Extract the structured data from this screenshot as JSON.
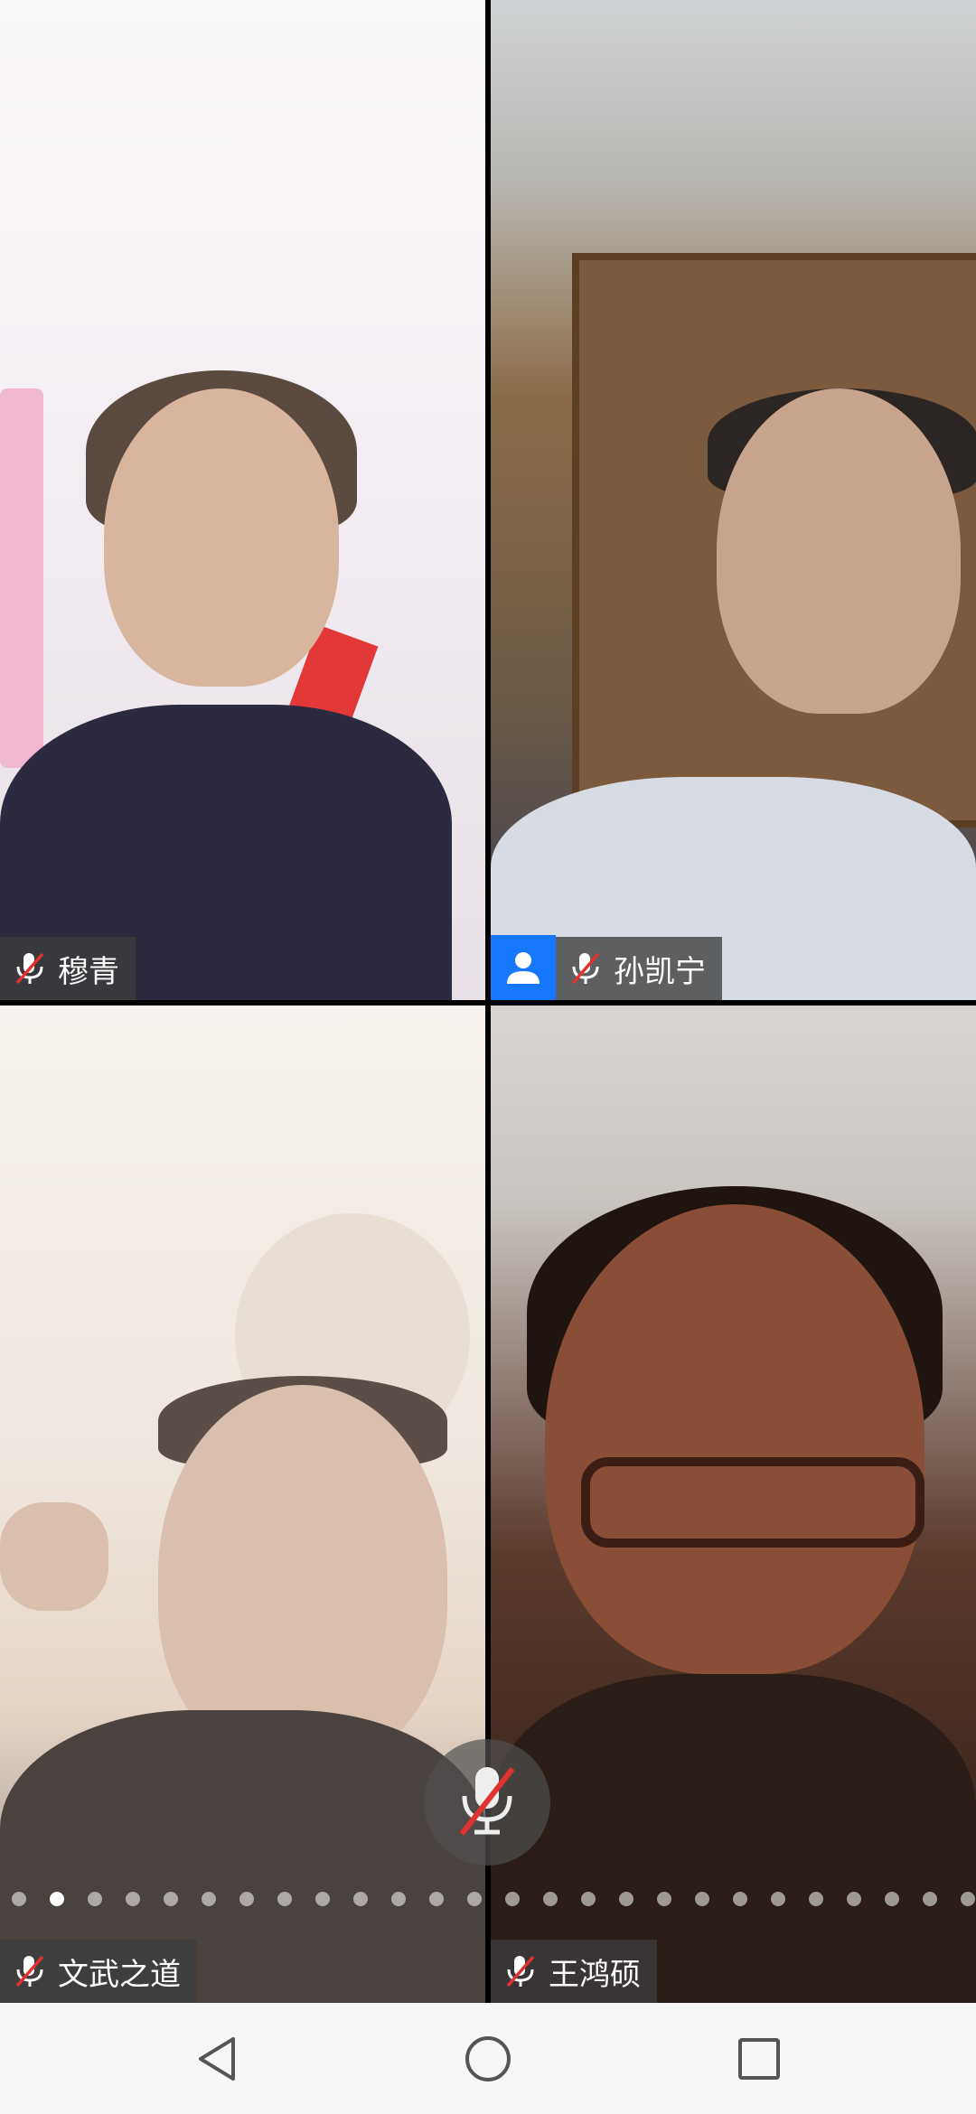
{
  "participants": [
    {
      "name": "穆青",
      "muted": true,
      "has_avatar_badge": false
    },
    {
      "name": "孙凯宁",
      "muted": true,
      "has_avatar_badge": true
    },
    {
      "name": "文武之道",
      "muted": true,
      "has_avatar_badge": false
    },
    {
      "name": "王鸿硕",
      "muted": true,
      "has_avatar_badge": false
    }
  ],
  "controls": {
    "center_mic_icon": "mic-muted-icon"
  },
  "pager": {
    "total_pages": 26,
    "active_index": 1
  },
  "navbar": {
    "back_icon": "back-triangle-icon",
    "home_icon": "home-circle-icon",
    "recents_icon": "recents-square-icon"
  },
  "colors": {
    "badge_blue": "#1677ff",
    "muted_slash_red": "#e0322f"
  }
}
